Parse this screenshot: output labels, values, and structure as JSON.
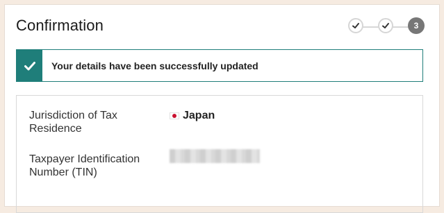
{
  "page": {
    "title": "Confirmation"
  },
  "stepper": {
    "steps": [
      {
        "state": "done",
        "icon": "check-icon"
      },
      {
        "state": "done",
        "icon": "check-icon"
      },
      {
        "state": "current",
        "label": "3"
      }
    ]
  },
  "alert": {
    "message": "Your details have been successfully updated",
    "icon": "check-icon",
    "color": "#1f7e7a"
  },
  "details": {
    "rows": [
      {
        "label": "Jurisdiction of Tax Residence",
        "value": "Japan",
        "flag_icon": "japan-flag-icon"
      },
      {
        "label": "Taxpayer Identification Number (TIN)",
        "value_masked": true
      }
    ]
  }
}
